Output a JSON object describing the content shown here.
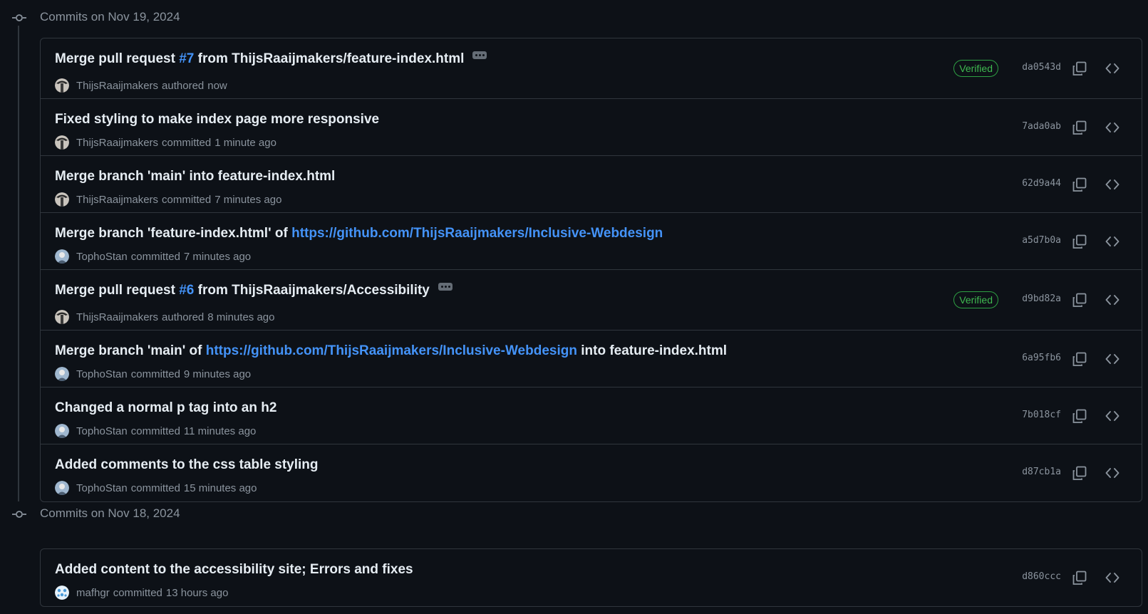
{
  "colors": {
    "background": "#0d1117",
    "border": "#30363d",
    "muted": "#8b949e",
    "text": "#e6edf3",
    "link": "#4493f8",
    "verified": "#3fb950"
  },
  "icons": {
    "commit": "git-commit-icon",
    "copy": "copy-icon",
    "browse": "code-icon",
    "more": "ellipsis-icon"
  },
  "groups": [
    {
      "title": "Commits on Nov 19, 2024",
      "commits": [
        {
          "title_parts": [
            {
              "text": "Merge pull request ",
              "link": false
            },
            {
              "text": "#7",
              "link": true
            },
            {
              "text": " from ThijsRaaijmakers/feature-index.html",
              "link": false
            }
          ],
          "has_ellipsis": true,
          "author": "ThijsRaaijmakers",
          "verb": "authored",
          "time": "now",
          "verified": "Verified",
          "sha": "da0543d",
          "avatar": "thijs"
        },
        {
          "title_parts": [
            {
              "text": "Fixed styling to make index page more responsive",
              "link": false
            }
          ],
          "has_ellipsis": false,
          "author": "ThijsRaaijmakers",
          "verb": "committed",
          "time": "1 minute ago",
          "verified": "",
          "sha": "7ada0ab",
          "avatar": "thijs"
        },
        {
          "title_parts": [
            {
              "text": "Merge branch 'main' into feature-index.html",
              "link": false
            }
          ],
          "has_ellipsis": false,
          "author": "ThijsRaaijmakers",
          "verb": "committed",
          "time": "7 minutes ago",
          "verified": "",
          "sha": "62d9a44",
          "avatar": "thijs"
        },
        {
          "title_parts": [
            {
              "text": "Merge branch 'feature-index.html' of ",
              "link": false
            },
            {
              "text": "https://github.com/ThijsRaaijmakers/Inclusive-Webdesign",
              "link": true
            }
          ],
          "has_ellipsis": false,
          "author": "TophoStan",
          "verb": "committed",
          "time": "7 minutes ago",
          "verified": "",
          "sha": "a5d7b0a",
          "avatar": "stan"
        },
        {
          "title_parts": [
            {
              "text": "Merge pull request ",
              "link": false
            },
            {
              "text": "#6",
              "link": true
            },
            {
              "text": " from ThijsRaaijmakers/Accessibility",
              "link": false
            }
          ],
          "has_ellipsis": true,
          "author": "ThijsRaaijmakers",
          "verb": "authored",
          "time": "8 minutes ago",
          "verified": "Verified",
          "sha": "d9bd82a",
          "avatar": "thijs"
        },
        {
          "title_parts": [
            {
              "text": "Merge branch 'main' of ",
              "link": false
            },
            {
              "text": "https://github.com/ThijsRaaijmakers/Inclusive-Webdesign",
              "link": true
            },
            {
              "text": " into feature-index.html",
              "link": false
            }
          ],
          "has_ellipsis": false,
          "author": "TophoStan",
          "verb": "committed",
          "time": "9 minutes ago",
          "verified": "",
          "sha": "6a95fb6",
          "avatar": "stan"
        },
        {
          "title_parts": [
            {
              "text": "Changed a normal p tag into an h2",
              "link": false
            }
          ],
          "has_ellipsis": false,
          "author": "TophoStan",
          "verb": "committed",
          "time": "11 minutes ago",
          "verified": "",
          "sha": "7b018cf",
          "avatar": "stan"
        },
        {
          "title_parts": [
            {
              "text": "Added comments to the css table styling",
              "link": false
            }
          ],
          "has_ellipsis": false,
          "author": "TophoStan",
          "verb": "committed",
          "time": "15 minutes ago",
          "verified": "",
          "sha": "d87cb1a",
          "avatar": "stan"
        }
      ]
    },
    {
      "title": "Commits on Nov 18, 2024",
      "commits": [
        {
          "title_parts": [
            {
              "text": "Added content to the accessibility site; Errors and fixes",
              "link": false
            }
          ],
          "has_ellipsis": false,
          "author": "mafhgr",
          "verb": "committed",
          "time": "13 hours ago",
          "verified": "",
          "sha": "d860ccc",
          "avatar": "mafhgr"
        }
      ]
    }
  ]
}
